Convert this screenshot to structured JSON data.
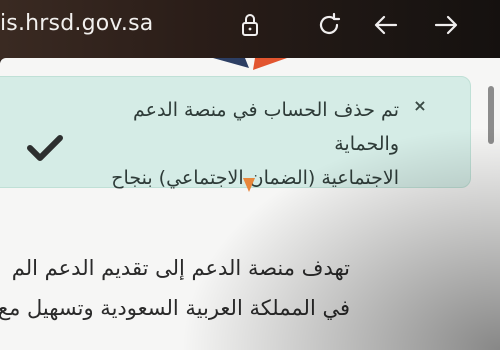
{
  "browser": {
    "url_text": "is.hrsd.gov.sa",
    "icons": [
      "lock-icon",
      "reload-icon",
      "back-arrow-icon",
      "forward-arrow-icon"
    ]
  },
  "alert": {
    "message_line1": "تم حذف الحساب في منصة الدعم والحماية",
    "message_line2": "الاجتماعية (الضمان الاجتماعي) بنجاح",
    "close_symbol": "×",
    "status_icon": "check-icon",
    "background_color": "#d5ece6"
  },
  "content": {
    "line1": "تهدف منصة الدعم إلى تقديم الدعم الم",
    "line2": "في المملكة العربية السعودية وتسهيل مع"
  }
}
